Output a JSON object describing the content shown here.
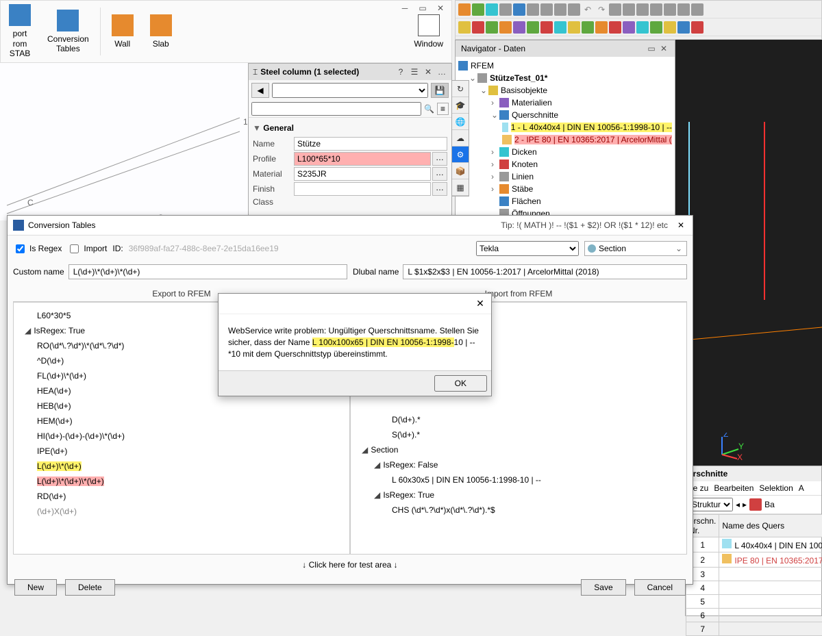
{
  "ribbon": {
    "btn1": "port\nrom\nSTAB",
    "btn2": "Conversion\nTables",
    "btn3": "Wall",
    "btn4": "Slab",
    "btn5": "Window"
  },
  "navigator": {
    "title": "Navigator - Daten",
    "root": "RFEM",
    "model": "StützeTest_01*",
    "basis": "Basisobjekte",
    "mat": "Materialien",
    "quer": "Querschnitte",
    "q1": "1 - L 40x40x4 | DIN EN 10056-1:1998-10 | --",
    "q2": "2 - IPE 80 | EN 10365:2017 | ArcelorMittal (",
    "dicken": "Dicken",
    "knoten": "Knoten",
    "linien": "Linien",
    "staebe": "Stäbe",
    "flaechen": "Flächen",
    "oeff": "Öffnungen"
  },
  "steel": {
    "title": "Steel column (1 selected)",
    "general": "General",
    "name_lbl": "Name",
    "name_val": "Stütze",
    "profile_lbl": "Profile",
    "profile_val": "L100*65*10",
    "material_lbl": "Material",
    "material_val": "S235JR",
    "finish_lbl": "Finish",
    "class_lbl": "Class"
  },
  "conv": {
    "title": "Conversion Tables",
    "tip": "Tip: !( MATH )! -- !($1 + $2)! OR !($1 * 12)! etc",
    "is_regex": "Is Regex",
    "import": "Import",
    "id_lbl": "ID:",
    "id_val": "36f989af-fa27-488c-8ee7-2e15da16ee19",
    "sel1": "Tekla",
    "sel2": "Section",
    "custom_lbl": "Custom name",
    "custom_val": "L(\\d+)\\*(\\d+)\\*(\\d+)",
    "dlubal_lbl": "Dlubal name",
    "dlubal_val": "L $1x$2x$3 | EN 10056-1:2017 | ArcelorMittal (2018)",
    "export_hdr": "Export to RFEM",
    "import_hdr": "Import from RFEM",
    "test": "↓ Click here for test area ↓",
    "new": "New",
    "delete": "Delete",
    "save": "Save",
    "cancel": "Cancel",
    "left_items": {
      "i0": "L60*30*5",
      "grp": "IsRegex:    True",
      "i1": "RO(\\d*\\.?\\d*)\\*(\\d*\\.?\\d*)",
      "i2": "^D(\\d+)",
      "i3": "FL(\\d+)\\*(\\d+)",
      "i4": "HEA(\\d+)",
      "i5": "HEB(\\d+)",
      "i6": "HEM(\\d+)",
      "i7": "HI(\\d+)-(\\d+)-(\\d+)\\*(\\d+)",
      "i8": "IPE(\\d+)",
      "i9": "L(\\d+)\\*(\\d+)",
      "i10": "L(\\d+)\\*(\\d+)\\*(\\d+)",
      "i11": "RD(\\d+)",
      "i12": "(\\d+)X(\\d+)"
    },
    "right_items": {
      "r1": "D(\\d+).*",
      "r2": "S(\\d+).*",
      "sec": "Section",
      "grpF": "IsRegex:    False",
      "r3": "L 60x30x5 | DIN EN 10056-1:1998-10 | --",
      "grpT": "IsRegex:    True",
      "r4": "CHS (\\d*\\.?\\d*)x(\\d*\\.?\\d*).*$"
    }
  },
  "err": {
    "line1_a": "WebService write problem: Ungültiger Querschnittsname. Stellen Sie sicher, dass der Name ",
    "line1_hl": "L 100x100x65 | DIN EN 10056-1:1998-",
    "line1_b": "10 | --*10 mit dem Querschnittstyp übereinstimmt.",
    "ok": "OK"
  },
  "qpanel": {
    "title": "erschnitte",
    "menu1": "he zu",
    "menu2": "Bearbeiten",
    "menu3": "Selektion",
    "menu4": "A",
    "sel": "Struktur",
    "ba": "Ba",
    "col1": "erschn.\nNr.",
    "col2": "Name des Quers",
    "r1": "1",
    "r1v": "L 40x40x4 | DIN EN 100",
    "r2": "2",
    "r2v": "IPE 80 | EN 10365:2017"
  }
}
